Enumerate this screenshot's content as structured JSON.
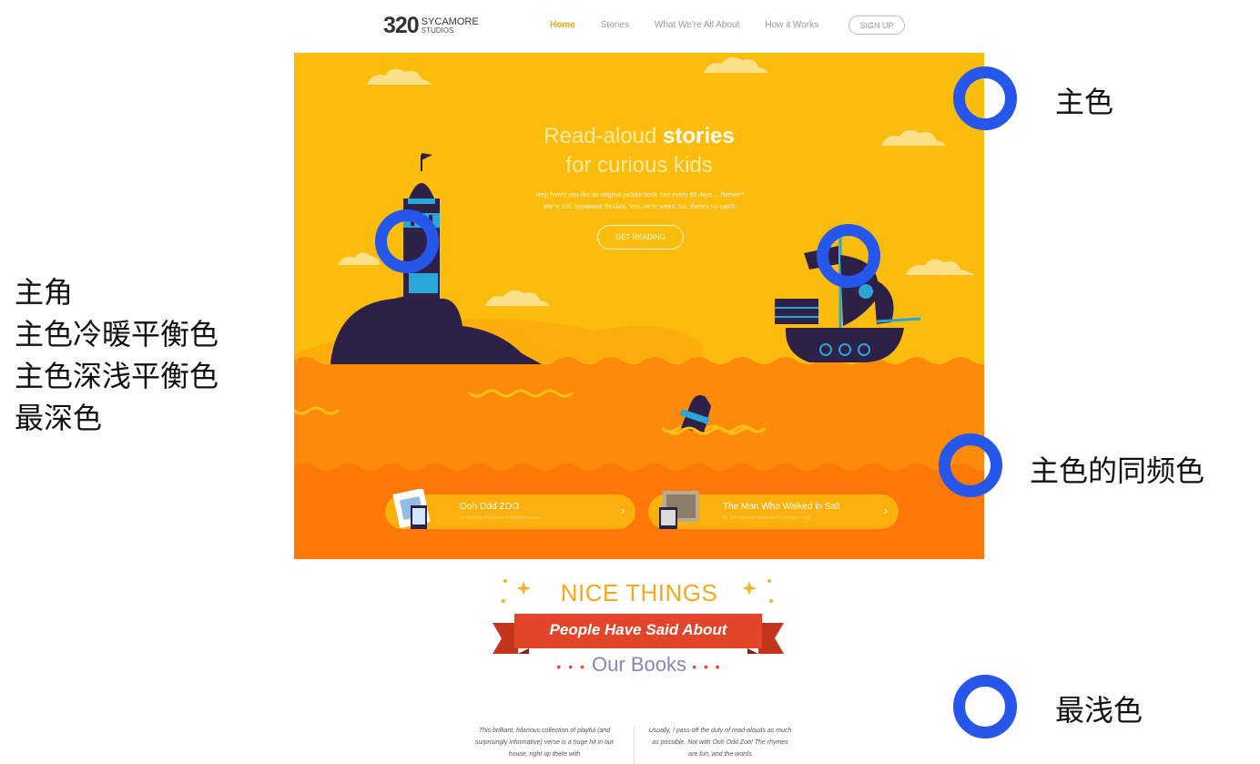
{
  "site": {
    "logo": {
      "number": "320",
      "name": "SYCAMORE",
      "sub": "STUDIOS"
    },
    "nav": [
      "Home",
      "Stories",
      "What We're All About",
      "How it Works"
    ],
    "active_nav": "Home",
    "signup_label": "SIGN UP",
    "hero": {
      "title_part1": "Read-aloud ",
      "title_bold": "stories",
      "title_line2": "for curious kids",
      "subtitle_line1": "Hey, how'd you like an original picture book free every 60 days ... forever?",
      "subtitle_line2": "We're 320 Sycamore Studios. Yes, we're weird. No, there's no catch.",
      "cta_label": "GET READING"
    },
    "books": [
      {
        "title": "Ooh Odd ZOO",
        "meta": "by Nicholas Bowers and Brittany Lucas"
      },
      {
        "title": "The Man Who Walked in Salt",
        "meta": "by Jeff Stevens / Illustrated by Megan Long"
      }
    ],
    "testimonials": {
      "line1": "NICE THINGS",
      "line2": "People Have Said About",
      "line3": "Our Books",
      "dots": "• • •",
      "quote_left": "This brilliant, hilarious collection of playful (and surprisingly informative) verse is a huge hit in our house, right up there with",
      "quote_right": "Usually, I pass off the duty of read-alouds as much as possible. Not with Ooh Odd Zoo! The rhymes are fun, and the words"
    }
  },
  "annotations": {
    "left_notes": [
      "主角",
      "主色冷暖平衡色",
      "主色深浅平衡色",
      "最深色"
    ],
    "right_labels": {
      "primary": "主色",
      "same_frequency": "主色的同频色",
      "lightest": "最浅色"
    }
  },
  "colors": {
    "primary_yellow": "#fbbd0d",
    "orange": "#fd8a0b",
    "deep_orange": "#fd7808",
    "dark_navy": "#2e2147",
    "teal": "#2aa7d6",
    "ribbon_red": "#e2452a",
    "annotation_blue": "#2657ea"
  }
}
